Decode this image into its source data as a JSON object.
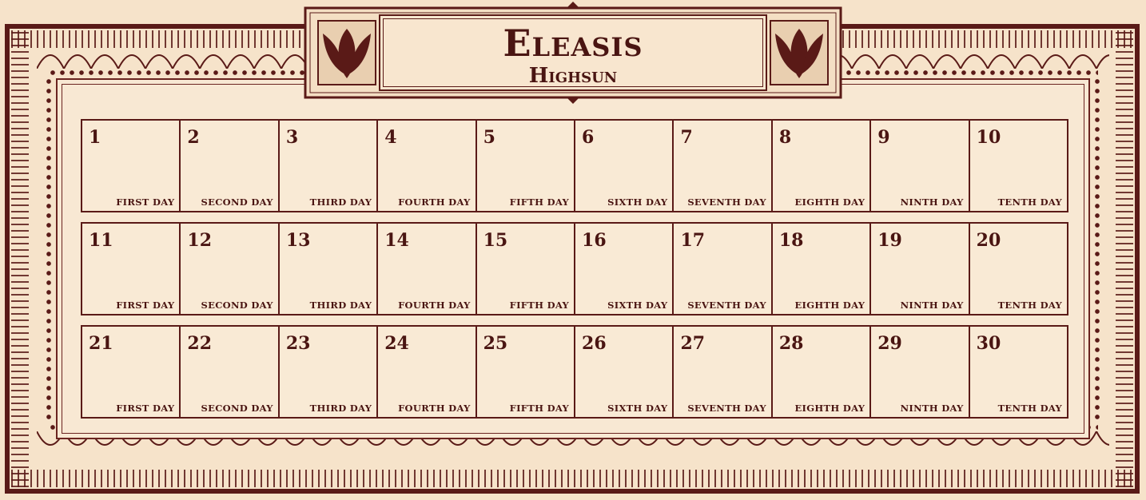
{
  "title": "Eleasis",
  "subtitle": "Highsun",
  "weeks": [
    [
      {
        "num": "1",
        "name": "FIRST DAY"
      },
      {
        "num": "2",
        "name": "SECOND DAY"
      },
      {
        "num": "3",
        "name": "THIRD DAY"
      },
      {
        "num": "4",
        "name": "FOURTH DAY"
      },
      {
        "num": "5",
        "name": "FIFTH DAY"
      },
      {
        "num": "6",
        "name": "SIXTH DAY"
      },
      {
        "num": "7",
        "name": "SEVENTH DAY"
      },
      {
        "num": "8",
        "name": "EIGHTH DAY"
      },
      {
        "num": "9",
        "name": "NINTH DAY"
      },
      {
        "num": "10",
        "name": "TENTH DAY"
      }
    ],
    [
      {
        "num": "11",
        "name": "FIRST DAY"
      },
      {
        "num": "12",
        "name": "SECOND DAY"
      },
      {
        "num": "13",
        "name": "THIRD DAY"
      },
      {
        "num": "14",
        "name": "FOURTH DAY"
      },
      {
        "num": "15",
        "name": "FIFTH DAY"
      },
      {
        "num": "16",
        "name": "SIXTH DAY"
      },
      {
        "num": "17",
        "name": "SEVENTH DAY"
      },
      {
        "num": "18",
        "name": "EIGHTH DAY"
      },
      {
        "num": "19",
        "name": "NINTH DAY"
      },
      {
        "num": "20",
        "name": "TENTH DAY"
      }
    ],
    [
      {
        "num": "21",
        "name": "FIRST DAY"
      },
      {
        "num": "22",
        "name": "SECOND DAY"
      },
      {
        "num": "23",
        "name": "THIRD DAY"
      },
      {
        "num": "24",
        "name": "FOURTH DAY"
      },
      {
        "num": "25",
        "name": "FIFTH DAY"
      },
      {
        "num": "26",
        "name": "SIXTH DAY"
      },
      {
        "num": "27",
        "name": "SEVENTH DAY"
      },
      {
        "num": "28",
        "name": "EIGHTH DAY"
      },
      {
        "num": "29",
        "name": "NINTH DAY"
      },
      {
        "num": "30",
        "name": "TENTH DAY"
      }
    ]
  ],
  "colors": {
    "ink": "#5a1a17",
    "parchment": "#f6e3ca"
  }
}
